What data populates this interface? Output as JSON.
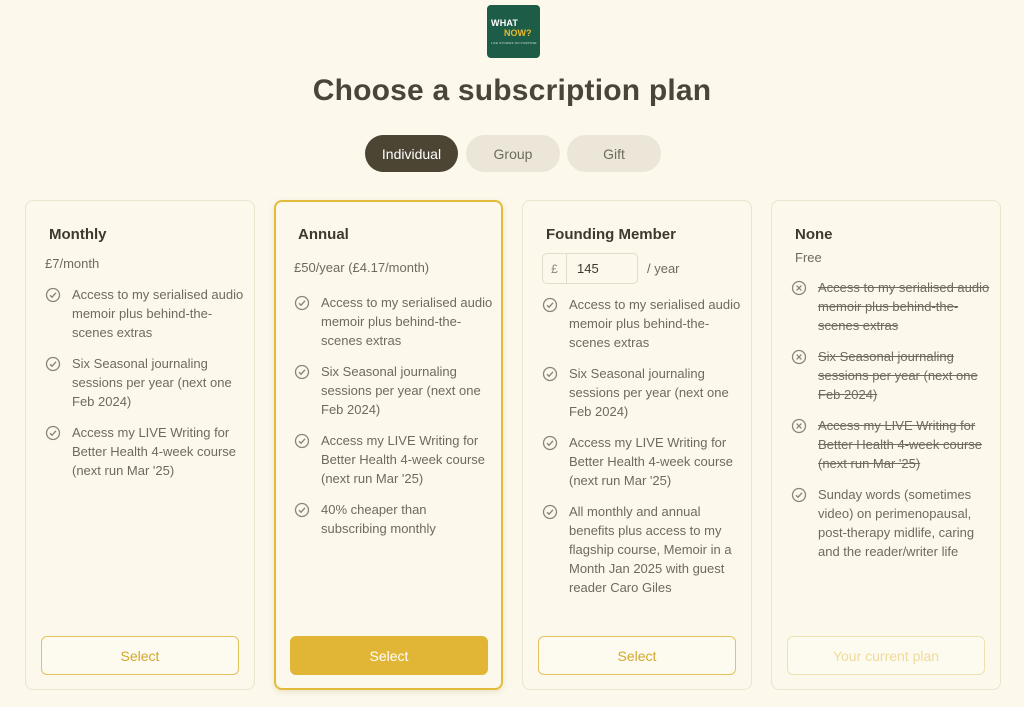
{
  "logo": {
    "line1": "WHAT",
    "line2": "NOW?",
    "tagline": "LIFE STORIES ON PURPOSE"
  },
  "title": "Choose a subscription plan",
  "tabs": [
    {
      "label": "Individual",
      "active": true
    },
    {
      "label": "Group",
      "active": false
    },
    {
      "label": "Gift",
      "active": false
    }
  ],
  "plans": [
    {
      "name": "Monthly",
      "price": "£7/month",
      "features": [
        "Access to my serialised audio memoir plus behind-the-scenes extras",
        "Six Seasonal journaling sessions per year (next one Feb 2024)",
        "Access my LIVE Writing for Better Health 4-week course (next run Mar '25)"
      ],
      "button": "Select"
    },
    {
      "name": "Annual",
      "price": "£50/year (£4.17/month)",
      "features": [
        "Access to my serialised audio memoir plus behind-the-scenes extras",
        "Six Seasonal journaling sessions per year (next one Feb 2024)",
        "Access my LIVE Writing for Better Health 4-week course (next run Mar '25)",
        "40% cheaper than subscribing monthly"
      ],
      "button": "Select"
    },
    {
      "name": "Founding Member",
      "currency": "£",
      "amount": "145",
      "period": "/ year",
      "features": [
        "Access to my serialised audio memoir plus behind-the-scenes extras",
        "Six Seasonal journaling sessions per year (next one Feb 2024)",
        "Access my LIVE Writing for Better Health 4-week course (next run Mar '25)",
        "All monthly and annual benefits plus access to my flagship course, Memoir in a Month Jan 2025 with guest reader Caro Giles"
      ],
      "button": "Select"
    },
    {
      "name": "None",
      "price": "Free",
      "features": [
        "Access to my serialised audio memoir plus behind-the-scenes extras",
        "Six Seasonal journaling sessions per year (next one Feb 2024)",
        "Access my LIVE Writing for Better Health 4-week course (next run Mar '25)",
        "Sunday words (sometimes video) on perimenopausal, post-therapy midlife, caring and the reader/writer life"
      ],
      "button": "Your current plan"
    }
  ],
  "colors": {
    "accent": "#e1b636",
    "tab_active": "#4d4533",
    "logo_bg": "#1d5d47",
    "background": "#fcf8ec"
  }
}
